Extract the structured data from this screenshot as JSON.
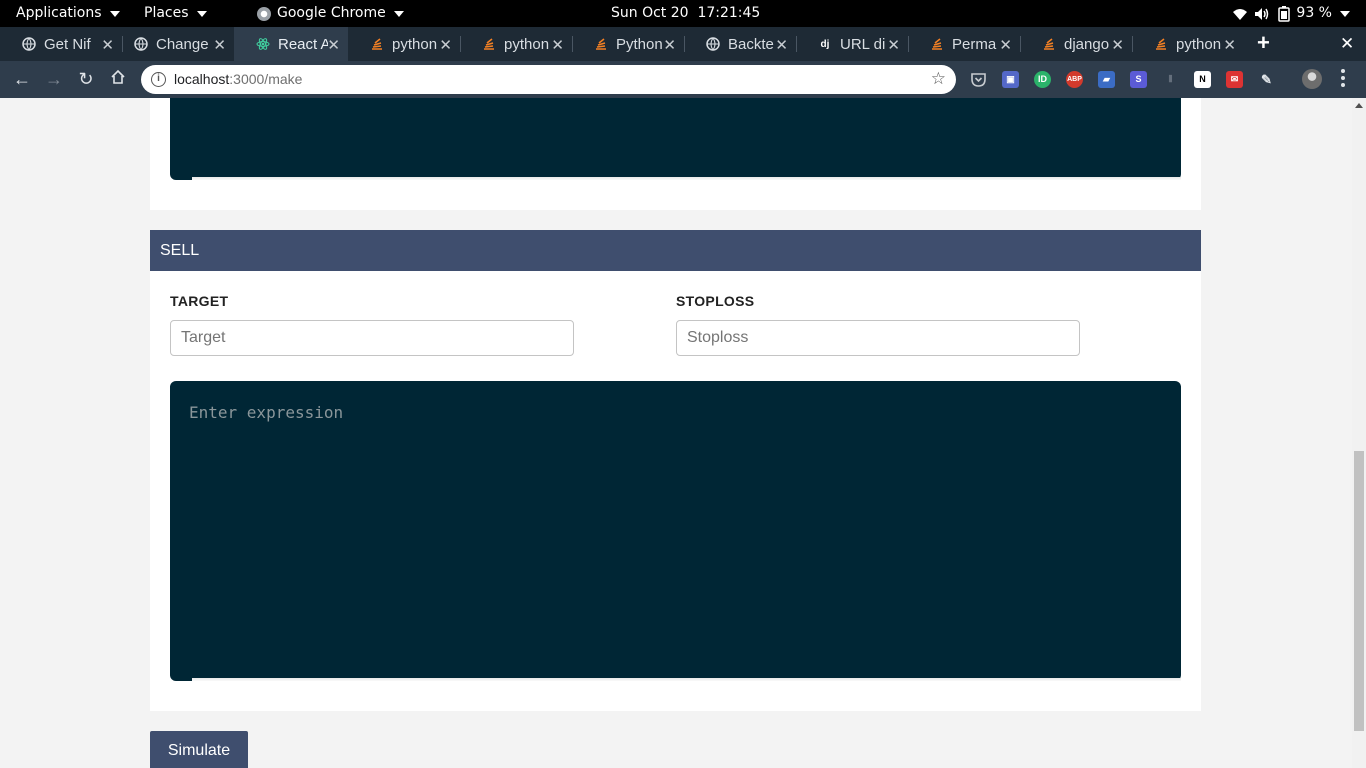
{
  "system_bar": {
    "applications": "Applications",
    "places": "Places",
    "browser_app": "Google Chrome",
    "datetime": "Sun Oct 20  17:21:45",
    "battery": "93 %"
  },
  "tabs": [
    {
      "title": "Get Nif",
      "icon": "globe-icon"
    },
    {
      "title": "Change",
      "icon": "globe-icon"
    },
    {
      "title": "React A",
      "icon": "react-icon",
      "active": true
    },
    {
      "title": "python",
      "icon": "stackoverflow-icon"
    },
    {
      "title": "python",
      "icon": "stackoverflow-icon"
    },
    {
      "title": "Python",
      "icon": "stackoverflow-icon"
    },
    {
      "title": "Backte",
      "icon": "globe-icon"
    },
    {
      "title": "URL di",
      "icon": "django-icon",
      "favicon_text": "dj"
    },
    {
      "title": "Perma",
      "icon": "stackoverflow-icon"
    },
    {
      "title": "django",
      "icon": "stackoverflow-icon"
    },
    {
      "title": "python",
      "icon": "stackoverflow-icon"
    }
  ],
  "address_bar": {
    "host": "localhost",
    "path": ":3000/make"
  },
  "sell_section": {
    "header": "SELL",
    "target_label": "TARGET",
    "target_placeholder": "Target",
    "stoploss_label": "STOPLOSS",
    "stoploss_placeholder": "Stoploss",
    "expression_placeholder": "Enter expression"
  },
  "actions": {
    "simulate_label": "Simulate"
  },
  "colors": {
    "accent": "#3f4e6e",
    "editor_bg": "#002635",
    "page_bg": "#f3f3f3"
  }
}
